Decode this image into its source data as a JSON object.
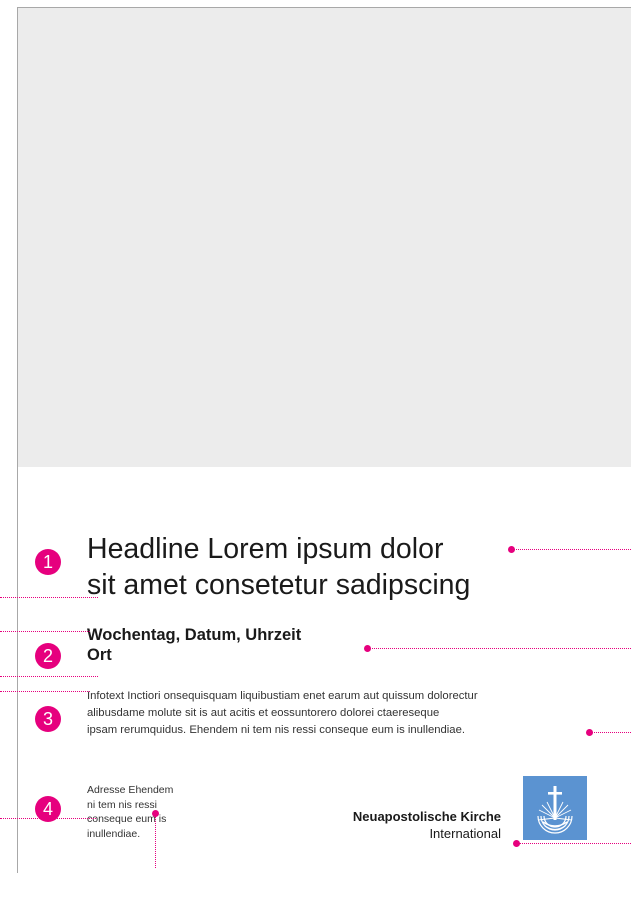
{
  "poster": {
    "badges": [
      "1",
      "2",
      "3",
      "4"
    ],
    "headline": [
      "Headline Lorem ipsum dolor",
      "sit amet consetetur sadipscing"
    ],
    "when": [
      "Wochentag, Datum, Uhrzeit",
      "Ort"
    ],
    "infotext": [
      "Infotext Inctiori onsequisquam liquibustiam enet earum aut quissum dolorectur",
      "alibusdame molute sit is aut acitis et eossuntorero dolorei ctaereseque",
      "ipsam rerumquidus. Ehendem ni tem nis ressi conseque eum is inullendiae."
    ],
    "address": [
      "Adresse Ehendem",
      "ni tem nis ressi",
      "conseque eum is",
      "inullendiae."
    ],
    "church": {
      "name": "Neuapostolische Kirche",
      "subtitle": "International"
    },
    "logo_icon": "church-emblem-icon",
    "colors": {
      "accent": "#e6007e",
      "logo_bg": "#5b93d1",
      "image_placeholder": "#ececec"
    }
  }
}
